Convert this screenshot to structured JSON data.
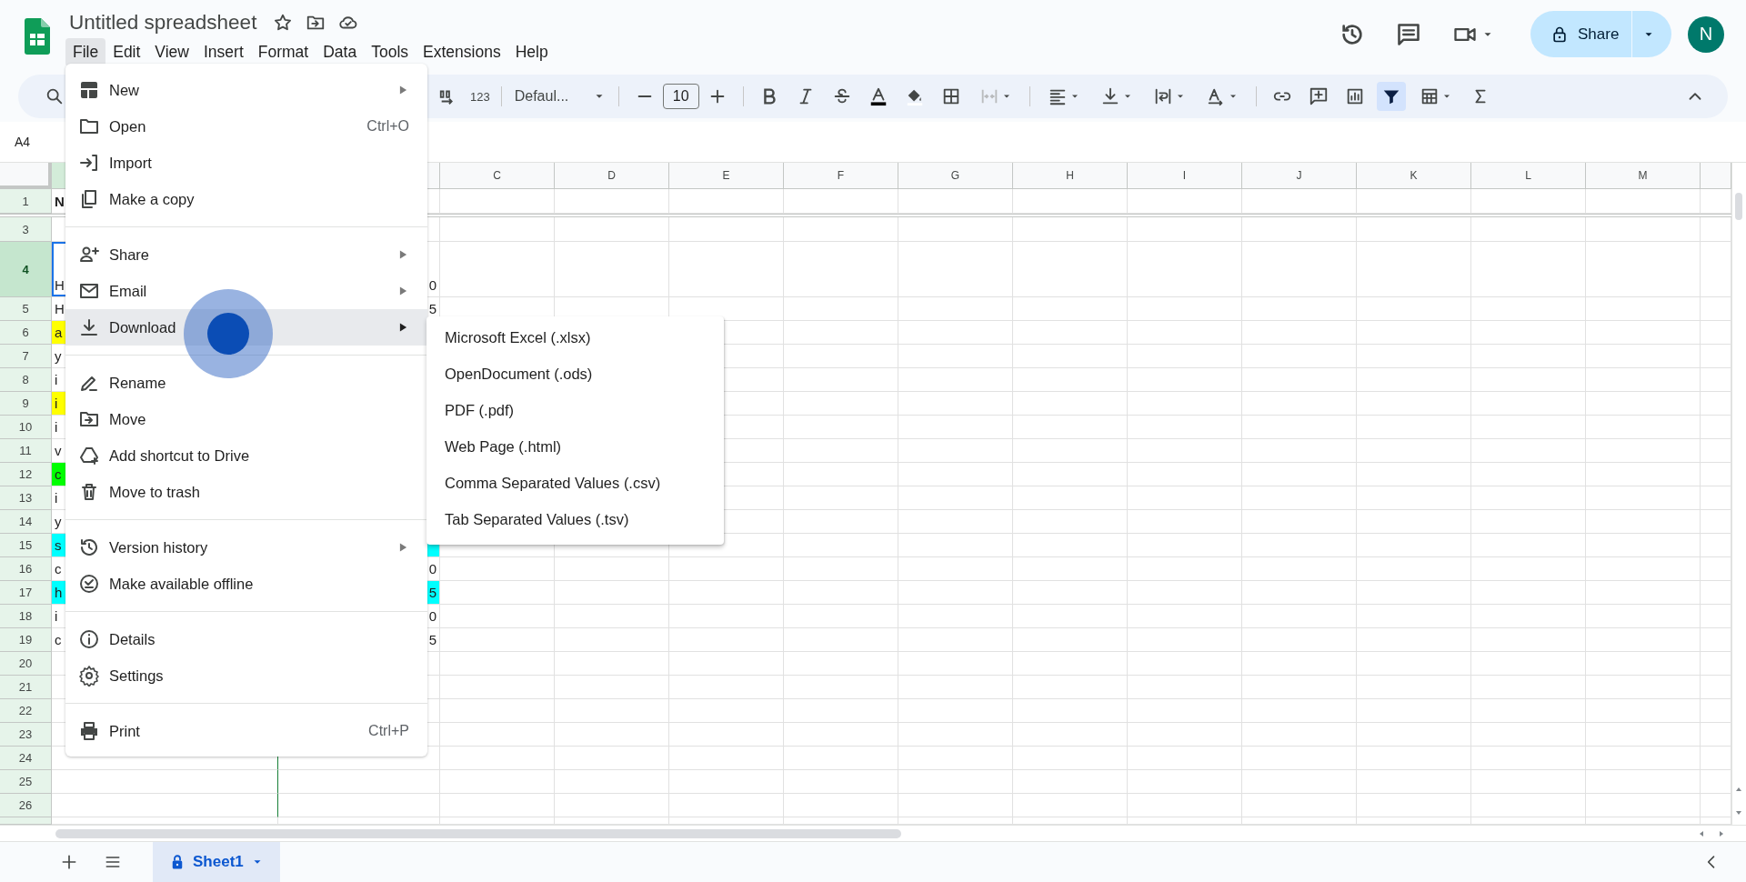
{
  "document": {
    "title": "Untitled spreadsheet"
  },
  "menubar": [
    {
      "label": "File",
      "selected": true
    },
    {
      "label": "Edit",
      "selected": false
    },
    {
      "label": "View",
      "selected": false
    },
    {
      "label": "Insert",
      "selected": false
    },
    {
      "label": "Format",
      "selected": false
    },
    {
      "label": "Data",
      "selected": false
    },
    {
      "label": "Tools",
      "selected": false
    },
    {
      "label": "Extensions",
      "selected": false
    },
    {
      "label": "Help",
      "selected": false
    }
  ],
  "share": {
    "label": "Share"
  },
  "account": {
    "initial": "N"
  },
  "toolbar": {
    "number_format": "123",
    "font": "Defaul...",
    "font_size": "10",
    "merge_disabled": true,
    "filter_selected": true
  },
  "name_box": "A4",
  "grid": {
    "columns": [
      "C",
      "D",
      "E",
      "F",
      "G",
      "H",
      "I",
      "J",
      "K",
      "L",
      "M"
    ],
    "rows": [
      {
        "number": "1",
        "selected": false,
        "hidden_after": true,
        "a": {
          "text": "N",
          "bold": true
        }
      },
      {
        "number": "3",
        "selected": false,
        "hidden_after": false
      },
      {
        "number": "4",
        "selected": true,
        "hidden_after": false,
        "a": {
          "text": "H"
        },
        "b": {
          "text": "0"
        }
      },
      {
        "number": "5",
        "selected": false,
        "hidden_after": false,
        "a": {
          "text": "H"
        },
        "b": {
          "text": "5"
        }
      },
      {
        "number": "6",
        "selected": false,
        "hidden_after": false,
        "a": {
          "text": "a",
          "color": "#ffff00"
        }
      },
      {
        "number": "7",
        "selected": false,
        "hidden_after": false,
        "a": {
          "text": "y"
        }
      },
      {
        "number": "8",
        "selected": false,
        "hidden_after": false,
        "a": {
          "text": "i"
        }
      },
      {
        "number": "9",
        "selected": false,
        "hidden_after": false,
        "a": {
          "text": "i",
          "color": "#ffff00"
        }
      },
      {
        "number": "10",
        "selected": false,
        "hidden_after": false,
        "a": {
          "text": "i"
        }
      },
      {
        "number": "11",
        "selected": false,
        "hidden_after": false,
        "a": {
          "text": "v"
        }
      },
      {
        "number": "12",
        "selected": false,
        "hidden_after": false,
        "a": {
          "text": "c",
          "color": "#00ff00"
        }
      },
      {
        "number": "13",
        "selected": false,
        "hidden_after": false,
        "a": {
          "text": "i"
        }
      },
      {
        "number": "14",
        "selected": false,
        "hidden_after": false,
        "a": {
          "text": "y"
        }
      },
      {
        "number": "15",
        "selected": false,
        "hidden_after": false,
        "a": {
          "text": "s",
          "color": "#00ffff"
        },
        "b": {
          "color": "#00ffff"
        }
      },
      {
        "number": "16",
        "selected": false,
        "hidden_after": false,
        "a": {
          "text": "c"
        },
        "b": {
          "text": "0"
        }
      },
      {
        "number": "17",
        "selected": false,
        "hidden_after": false,
        "a": {
          "text": "h",
          "color": "#00ffff"
        },
        "b": {
          "text": "5",
          "color": "#00ffff"
        }
      },
      {
        "number": "18",
        "selected": false,
        "hidden_after": false,
        "a": {
          "text": "i"
        },
        "b": {
          "text": "0"
        }
      },
      {
        "number": "19",
        "selected": false,
        "hidden_after": false,
        "a": {
          "text": "c"
        },
        "b": {
          "text": "5"
        }
      },
      {
        "number": "20",
        "selected": false,
        "hidden_after": false
      },
      {
        "number": "21",
        "selected": false,
        "hidden_after": false
      },
      {
        "number": "22",
        "selected": false,
        "hidden_after": false
      },
      {
        "number": "23",
        "selected": false,
        "hidden_after": false
      },
      {
        "number": "24",
        "selected": false,
        "hidden_after": false
      },
      {
        "number": "25",
        "selected": false,
        "hidden_after": false
      },
      {
        "number": "26",
        "selected": false,
        "hidden_after": false
      }
    ]
  },
  "file_menu": [
    {
      "kind": "item",
      "label": "New",
      "submenu": true,
      "selected": false
    },
    {
      "kind": "item",
      "label": "Open",
      "shortcut": "Ctrl+O",
      "submenu": false,
      "selected": false
    },
    {
      "kind": "item",
      "label": "Import",
      "submenu": false,
      "selected": false
    },
    {
      "kind": "item",
      "label": "Make a copy",
      "submenu": false,
      "selected": false
    },
    {
      "kind": "divider"
    },
    {
      "kind": "item",
      "label": "Share",
      "submenu": true,
      "selected": false
    },
    {
      "kind": "item",
      "label": "Email",
      "submenu": true,
      "selected": false
    },
    {
      "kind": "item",
      "label": "Download",
      "submenu": true,
      "selected": true
    },
    {
      "kind": "divider"
    },
    {
      "kind": "item",
      "label": "Rename",
      "submenu": false,
      "selected": false
    },
    {
      "kind": "item",
      "label": "Move",
      "submenu": false,
      "selected": false
    },
    {
      "kind": "item",
      "label": "Add shortcut to Drive",
      "submenu": false,
      "selected": false
    },
    {
      "kind": "item",
      "label": "Move to trash",
      "submenu": false,
      "selected": false
    },
    {
      "kind": "divider"
    },
    {
      "kind": "item",
      "label": "Version history",
      "submenu": true,
      "selected": false
    },
    {
      "kind": "item",
      "label": "Make available offline",
      "submenu": false,
      "selected": false
    },
    {
      "kind": "divider"
    },
    {
      "kind": "item",
      "label": "Details",
      "submenu": false,
      "selected": false
    },
    {
      "kind": "item",
      "label": "Settings",
      "submenu": false,
      "selected": false
    },
    {
      "kind": "divider"
    },
    {
      "kind": "item",
      "label": "Print",
      "shortcut": "Ctrl+P",
      "submenu": false,
      "selected": false
    }
  ],
  "download_menu": [
    {
      "label": "Microsoft Excel (.xlsx)"
    },
    {
      "label": "OpenDocument (.ods)"
    },
    {
      "label": "PDF (.pdf)"
    },
    {
      "label": "Web Page (.html)"
    },
    {
      "label": "Comma Separated Values (.csv)"
    },
    {
      "label": "Tab Separated Values (.tsv)"
    }
  ],
  "sheets": [
    {
      "label": "Sheet1",
      "selected": true
    }
  ]
}
